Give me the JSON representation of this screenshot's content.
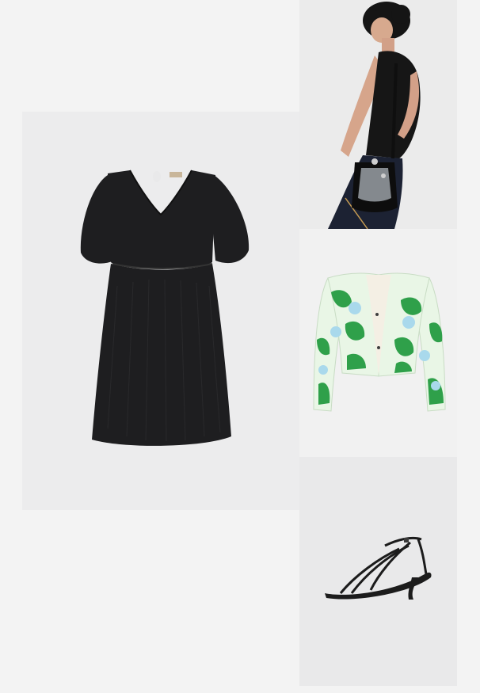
{
  "outfit": {
    "items": [
      {
        "id": "dress",
        "kind": "black puff-sleeve mini dress"
      },
      {
        "id": "bag",
        "kind": "transparent bucket bag worn by model"
      },
      {
        "id": "jacket",
        "kind": "green floral quilted jacket"
      },
      {
        "id": "sandal",
        "kind": "black strappy kitten-heel sandal"
      }
    ],
    "colors": {
      "page_bg": "#f3f3f3",
      "dress": "#1e1e20",
      "jacket_green": "#2fa04a",
      "jacket_blue": "#a9d9ec",
      "jacket_base": "#e9f6e6",
      "sandal": "#1c1c1c"
    }
  }
}
